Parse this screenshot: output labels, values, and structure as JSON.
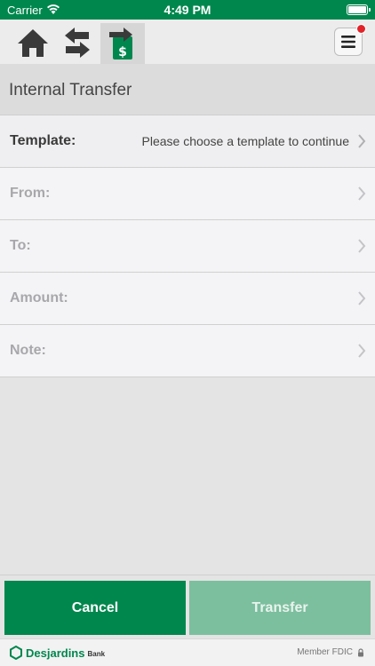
{
  "status_bar": {
    "carrier": "Carrier",
    "time": "4:49 PM"
  },
  "toolbar": {
    "home_icon": "home-icon",
    "swap_icon": "swap-arrows-icon",
    "transfer_icon": "transfer-dollar-icon",
    "menu_icon": "hamburger-menu-icon",
    "notification_color": "#e2232a"
  },
  "page": {
    "title": "Internal Transfer"
  },
  "form": {
    "template": {
      "label": "Template:",
      "value": "Please choose a template to continue"
    },
    "from": {
      "label": "From:"
    },
    "to": {
      "label": "To:"
    },
    "amount": {
      "label": "Amount:"
    },
    "note": {
      "label": "Note:"
    }
  },
  "actions": {
    "cancel_label": "Cancel",
    "transfer_label": "Transfer"
  },
  "footer": {
    "brand": "Desjardins",
    "brand_sub": "Bank",
    "fdic": "Member FDIC"
  },
  "colors": {
    "brand_green": "#00874e",
    "disabled_green": "#7cbf9e"
  }
}
